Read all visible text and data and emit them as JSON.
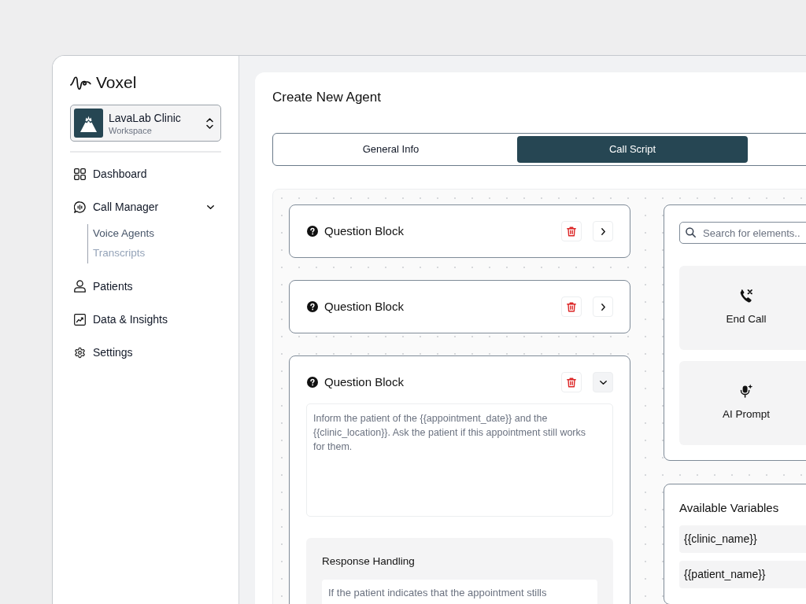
{
  "sidebar": {
    "logo": "Voxel",
    "workspace": {
      "name": "LavaLab Clinic",
      "label": "Workspace"
    },
    "nav": [
      {
        "label": "Dashboard"
      },
      {
        "label": "Call Manager",
        "expanded": true,
        "children": [
          {
            "label": "Voice Agents",
            "selected": true
          },
          {
            "label": "Transcripts",
            "selected": false
          }
        ]
      },
      {
        "label": "Patients"
      },
      {
        "label": "Data & Insights"
      },
      {
        "label": "Settings"
      }
    ]
  },
  "main": {
    "title": "Create New Agent",
    "tabs": [
      {
        "label": "General Info",
        "selected": false
      },
      {
        "label": "Call Script",
        "selected": true
      }
    ],
    "blocks": [
      {
        "title": "Question Block",
        "expanded": false
      },
      {
        "title": "Question Block",
        "expanded": false
      },
      {
        "title": "Question Block",
        "expanded": true,
        "prompt": "Inform the patient of the {{appointment_date}} and the {{clinic_location}}. Ask the patient if this appointment still works for them.",
        "response_handling": {
          "title": "Response Handling",
          "text": "If the patient indicates that the appointment stills"
        }
      }
    ],
    "elements_panel": {
      "search": {
        "placeholder": "Search for elements.."
      },
      "elements": [
        {
          "label": "End Call"
        },
        {
          "label": "AI Prompt"
        }
      ]
    },
    "variables_panel": {
      "title": "Available Variables",
      "variables": [
        "{{clinic_name}}",
        "{{patient_name}}"
      ]
    }
  }
}
